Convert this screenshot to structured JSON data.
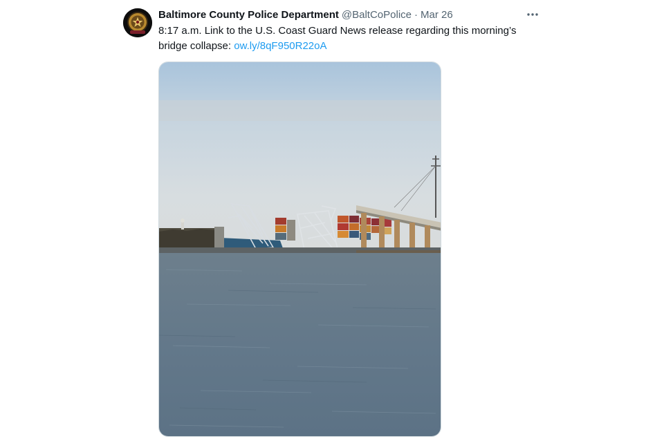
{
  "tweet": {
    "author_name": "Baltimore County Police Department",
    "handle": "@BaltCoPolice",
    "separator": "·",
    "date": "Mar 26",
    "text_prefix": "8:17 a.m. Link to the U.S. Coast Guard News release regarding this morning’s bridge collapse: ",
    "link_text": "ow.ly/8qF950R22oA",
    "more_icon": "more-horizontal-icon",
    "avatar_icon": "police-badge-logo",
    "media_description_icon": "photo-collapsed-bridge-cargo-ship"
  },
  "colors": {
    "text": "#0f1419",
    "secondary": "#536471",
    "link": "#1d9bf0"
  }
}
